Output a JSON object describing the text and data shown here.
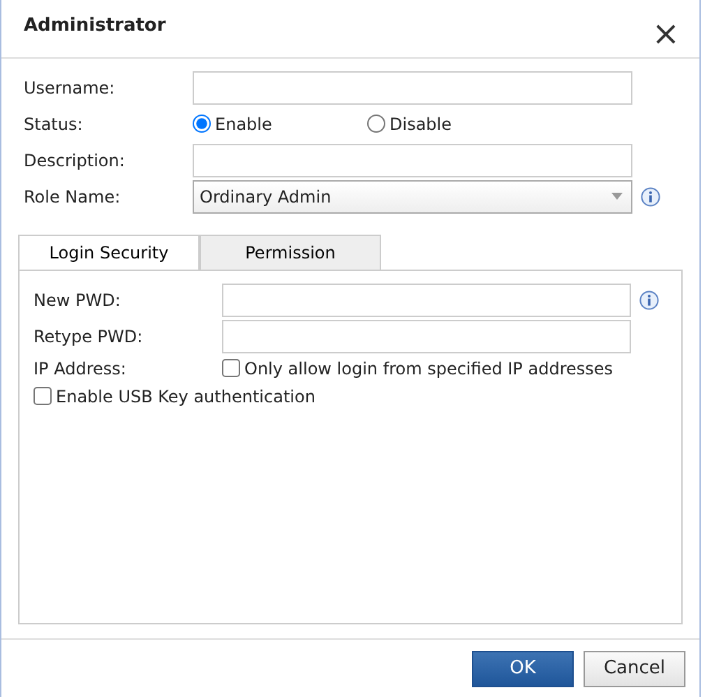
{
  "window": {
    "title": "Administrator",
    "close": "×"
  },
  "fields": [
    {
      "kind": "text",
      "label": "Username:"
    },
    {
      "kind": "radio",
      "label": "Status:",
      "options": [
        {
          "label": "Enable",
          "selected": true
        },
        {
          "label": "Disable",
          "selected": false
        }
      ]
    },
    {
      "kind": "text",
      "label": "Description:"
    },
    {
      "kind": "select",
      "label": "Role Name:",
      "value": "Ordinary Admin",
      "info": true
    }
  ],
  "tabs": [
    {
      "label": "Login Security",
      "selected": true
    },
    {
      "label": "Permission",
      "selected": false
    }
  ],
  "security": [
    {
      "kind": "password",
      "label": "New PWD:",
      "info": true
    },
    {
      "kind": "password",
      "label": "Retype PWD:",
      "info": false
    },
    {
      "kind": "check",
      "label": "IP Address:",
      "text": "Only allow login from specified IP addresses",
      "checked": false
    },
    {
      "kind": "check",
      "text": "Enable USB Key authentication",
      "checked": false
    }
  ],
  "buttons": [
    {
      "label": "OK",
      "primary": true
    },
    {
      "label": "Cancel",
      "primary": false
    }
  ]
}
